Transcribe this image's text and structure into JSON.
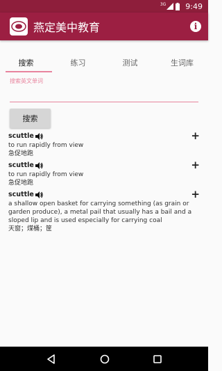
{
  "status_bar": {
    "network": "3G",
    "time": "9:49"
  },
  "app": {
    "title": "燕定美中教育",
    "info_icon": "info-icon",
    "accent": "#9c1f42",
    "tab_indicator": "#e8849e"
  },
  "tabs": [
    {
      "label": "搜索",
      "active": true
    },
    {
      "label": "练习",
      "active": false
    },
    {
      "label": "测试",
      "active": false
    },
    {
      "label": "生词库",
      "active": false
    }
  ],
  "search": {
    "placeholder": "搜索英文单词",
    "value": "",
    "button_label": "搜索"
  },
  "results": [
    {
      "word": "scuttle",
      "definition": "to run rapidly from view",
      "chinese": "急促地跑"
    },
    {
      "word": "scuttle",
      "definition": "to run rapidly from view",
      "chinese": "急促地跑"
    },
    {
      "word": "scuttle",
      "definition": "a shallow open basket for carrying something (as grain or garden produce), a metal pail that usually has a bail and a sloped lip and is used especially for carrying coal",
      "chinese": "天窗；煤桶；筐"
    }
  ],
  "result_add_label": "+",
  "nav": {
    "back": "back-icon",
    "home": "home-icon",
    "recents": "recents-icon"
  }
}
